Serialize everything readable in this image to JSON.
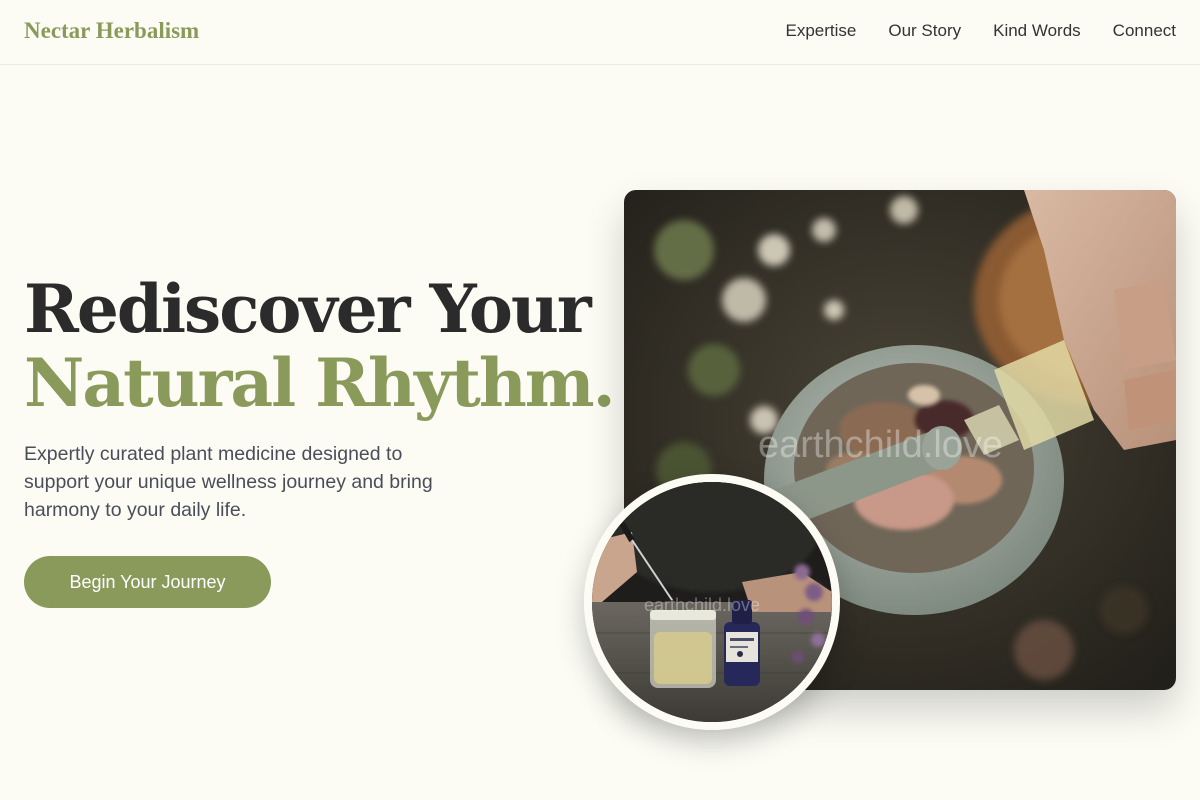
{
  "brand": {
    "name": "Nectar Herbalism",
    "accent": "#8a9a5b"
  },
  "nav": {
    "items": [
      {
        "label": "Expertise"
      },
      {
        "label": "Our Story"
      },
      {
        "label": "Kind Words"
      },
      {
        "label": "Connect"
      }
    ]
  },
  "hero": {
    "title_line1": "Rediscover Your",
    "title_line2": "Natural Rhythm.",
    "subtitle": "Expertly curated plant medicine designed to support your unique wellness journey and bring harmony to your daily life.",
    "cta_label": "Begin Your Journey"
  },
  "images": {
    "main_watermark": "earthchild.love",
    "inset_watermark": "earthchild.love"
  }
}
